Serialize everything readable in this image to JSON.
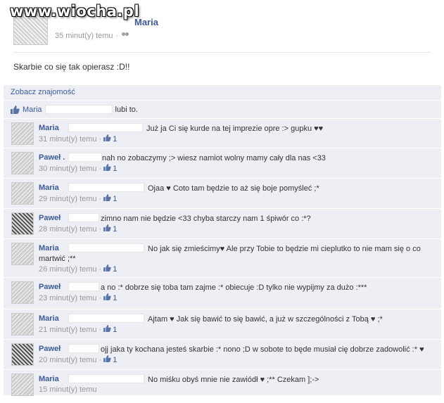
{
  "watermark": "www.wiocha.pl",
  "post": {
    "author": "Maria",
    "time": "35 minut(y) temu",
    "separator": "·",
    "message": "Skarbie co się tak opierasz :D!!"
  },
  "feedback": {
    "see_friendship": "Zobacz znajomość",
    "likes": {
      "name": "Maria",
      "suffix": "lubi to."
    }
  },
  "comments": [
    {
      "author": "Maria",
      "text": "Już ja Ci się kurde na tej imprezie opre :> gupku ♥♥",
      "time": "31 minut(y) temu",
      "likes": "1"
    },
    {
      "author": "Paweł .",
      "text": "nah no zobaczymy ;> wiesz namiot wolny mamy cały dla nas <33",
      "time": "30 minut(y) temu",
      "likes": "1"
    },
    {
      "author": "Maria",
      "text": "Ojaa ♥ Coto tam będzie to aż się boje pomyśleć ;*",
      "time": "29 minut(y) temu",
      "likes": "1"
    },
    {
      "author": "Paweł",
      "text": "zimno nam nie będzie <33 chyba starczy nam 1 śpiwór co :*?",
      "time": "28 minut(y) temu",
      "likes": "1"
    },
    {
      "author": "Maria",
      "text": "No jak się zmieścimy♥ Ale przy Tobie to będzie mi cieplutko to nie mam się o co",
      "text2": "martwić ;**",
      "time": "26 minut(y) temu",
      "likes": "1"
    },
    {
      "author": "Paweł",
      "text": "a no :* dobrze się toba tam zajme :* obiecuje :D tylko nie wypijmy za dużo :***",
      "time": "23 minut(y) temu",
      "likes": "1"
    },
    {
      "author": "Maria",
      "text": "Ajtam ♥ Jak się bawić to się bawić, a już w szczególności z Tobą ♥ ;*",
      "time": "21 minut(y) temu",
      "likes": "1"
    },
    {
      "author": "Paweł",
      "text": "ojj jaka ty kochana jesteś skarbie :* nono ;D w sobote to będe musiał cię dobrze zadowolić :* ♥",
      "time": "20 minut(y) temu",
      "likes": "1"
    },
    {
      "author": "Maria",
      "text": "No miśku obyś mnie nie zawiódł ♥ ;** Czekam ];->",
      "time": "15 minut(y) temu"
    }
  ]
}
